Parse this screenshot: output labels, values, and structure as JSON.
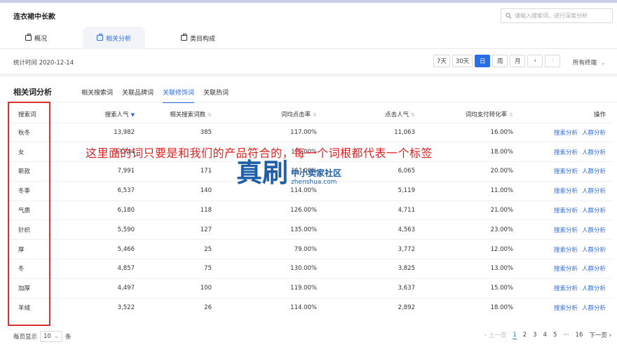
{
  "header": {
    "title": "连衣裙中长款",
    "search_placeholder": "请输入搜索词，进行深度分析",
    "tabs": [
      {
        "label": "概况",
        "active": false
      },
      {
        "label": "相关分析",
        "active": true
      },
      {
        "label": "类目构成",
        "active": false
      }
    ]
  },
  "statbar": {
    "time_label": "统计时间 2020-12-14",
    "periods": [
      "7天",
      "30天",
      "日",
      "周",
      "月"
    ],
    "active_period": "日",
    "prev": "‹",
    "next": "›",
    "terminal": "所有终端"
  },
  "panel": {
    "title": "相关词分析",
    "subtabs": [
      "相关搜索词",
      "关联品牌词",
      "关联修饰词",
      "关联热词"
    ],
    "active_subtab": "关联修饰词"
  },
  "table": {
    "columns": [
      "搜索词",
      "搜索人气",
      "相关搜索词数",
      "词均点击率",
      "点击人气",
      "词均支付转化率",
      "操作"
    ],
    "action_labels": [
      "搜索分析",
      "人群分析"
    ],
    "rows": [
      [
        "秋冬",
        "13,982",
        "385",
        "117.00%",
        "11,063",
        "16.00%"
      ],
      [
        "女",
        "1?,?44",
        "",
        "1?5.00%",
        "",
        "18.00%"
      ],
      [
        "新款",
        "7,991",
        "171",
        "11?.00%",
        "6,065",
        "20.00%"
      ],
      [
        "冬季",
        "6,537",
        "140",
        "114.00%",
        "5,119",
        "11.00%"
      ],
      [
        "气质",
        "6,180",
        "118",
        "126.00%",
        "4,711",
        "21.00%"
      ],
      [
        "针织",
        "5,590",
        "127",
        "135.00%",
        "4,563",
        "23.00%"
      ],
      [
        "厚",
        "5,466",
        "25",
        "79.00%",
        "3,772",
        "12.00%"
      ],
      [
        "冬",
        "4,857",
        "75",
        "130.00%",
        "3,825",
        "13.00%"
      ],
      [
        "加厚",
        "4,497",
        "100",
        "119.00%",
        "3,637",
        "15.00%"
      ],
      [
        "羊绒",
        "3,522",
        "26",
        "114.00%",
        "2,892",
        "18.00%"
      ]
    ]
  },
  "footer": {
    "page_size_label": "每页显示",
    "page_size": "10",
    "page_size_unit": "条",
    "prev": "上一页",
    "pages": [
      "1",
      "2",
      "3",
      "4",
      "5",
      "···",
      "16"
    ],
    "current_page": "1",
    "next": "下一页"
  },
  "annotation": {
    "text": "这里面的词只要是和我们的产品符合的，每一个词根都代表一个标签"
  },
  "watermark": {
    "big": "真刷",
    "cn": "中小卖家社区",
    "domain": "zhenshua.com"
  },
  "colors": {
    "accent": "#2a6de8",
    "annotation_red": "#e02020",
    "watermark_blue": "#1e5fa8"
  }
}
